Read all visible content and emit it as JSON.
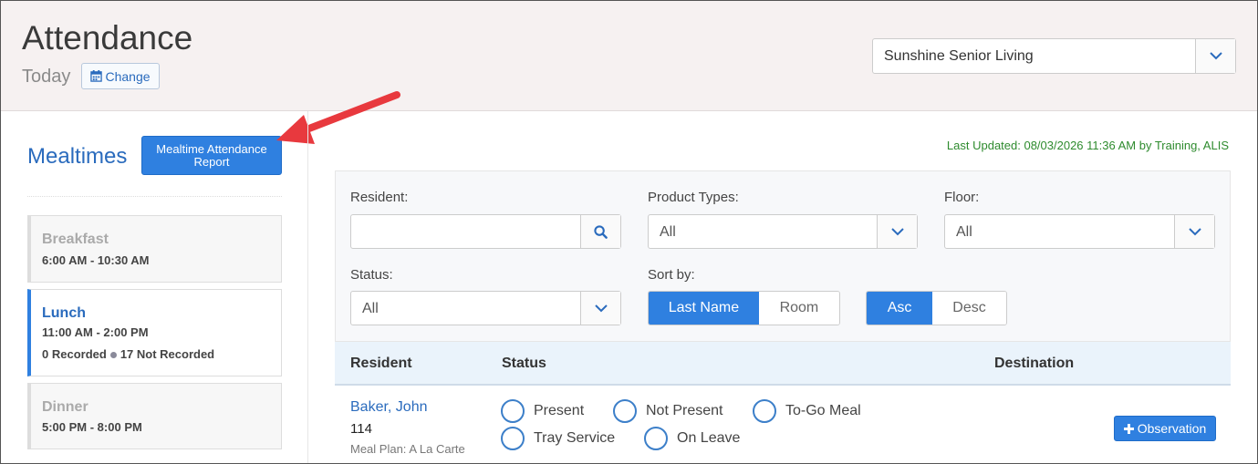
{
  "header": {
    "title": "Attendance",
    "date_label": "Today",
    "change_label": "Change",
    "community_value": "Sunshine Senior Living"
  },
  "sidebar": {
    "heading": "Mealtimes",
    "report_button": "Mealtime Attendance Report",
    "meals": [
      {
        "name": "Breakfast",
        "time": "6:00 AM - 10:30 AM"
      },
      {
        "name": "Lunch",
        "time": "11:00 AM - 2:00 PM",
        "recorded": "0 Recorded",
        "not_recorded": "17 Not Recorded"
      },
      {
        "name": "Dinner",
        "time": "5:00 PM - 8:00 PM"
      }
    ]
  },
  "main": {
    "last_updated": "Last Updated: 08/03/2026 11:36 AM by Training, ALIS",
    "filters": {
      "resident_label": "Resident:",
      "resident_value": "",
      "product_types_label": "Product Types:",
      "product_types_value": "All",
      "floor_label": "Floor:",
      "floor_value": "All",
      "status_label": "Status:",
      "status_value": "All",
      "sort_label": "Sort by:",
      "sort_options": [
        "Last Name",
        "Room"
      ],
      "order_options": [
        "Asc",
        "Desc"
      ]
    },
    "table": {
      "headers": [
        "Resident",
        "Status",
        "Destination"
      ],
      "rows": [
        {
          "name": "Baker, John",
          "room": "114",
          "meal_plan": "Meal Plan: A La Carte",
          "status_options": [
            "Present",
            "Not Present",
            "To-Go Meal",
            "Tray Service",
            "On Leave"
          ],
          "observation_label": "Observation"
        }
      ]
    }
  },
  "colors": {
    "accent": "#2f80e0",
    "link": "#2a6bbd",
    "updated_text": "#2e8b2e",
    "annotation_arrow": "#e8393e"
  }
}
